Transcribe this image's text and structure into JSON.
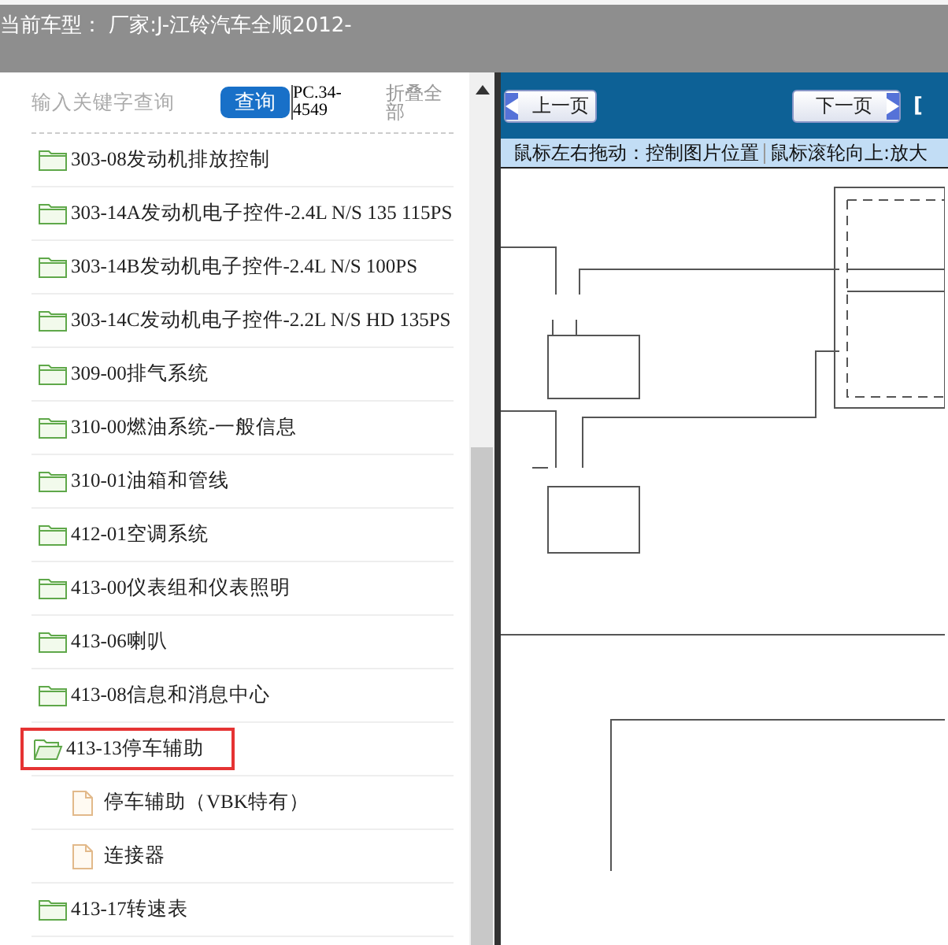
{
  "header": {
    "title": "当前车型：  厂家:J-江铃汽车全顺2012-"
  },
  "search": {
    "placeholder": "输入关键字查询",
    "button": "查询",
    "code": "PC.34-4549",
    "collapse": "折叠全部"
  },
  "tree": [
    {
      "kind": "folder",
      "label": "303-08发动机排放控制",
      "expanded": false,
      "selected": false
    },
    {
      "kind": "folder",
      "label": "303-14A发动机电子控件-2.4L N/S 135 115PS",
      "expanded": false,
      "selected": false
    },
    {
      "kind": "folder",
      "label": "303-14B发动机电子控件-2.4L N/S 100PS",
      "expanded": false,
      "selected": false
    },
    {
      "kind": "folder",
      "label": "303-14C发动机电子控件-2.2L N/S HD 135PS",
      "expanded": false,
      "selected": false
    },
    {
      "kind": "folder",
      "label": "309-00排气系统",
      "expanded": false,
      "selected": false
    },
    {
      "kind": "folder",
      "label": "310-00燃油系统-一般信息",
      "expanded": false,
      "selected": false
    },
    {
      "kind": "folder",
      "label": "310-01油箱和管线",
      "expanded": false,
      "selected": false
    },
    {
      "kind": "folder",
      "label": "412-01空调系统",
      "expanded": false,
      "selected": false
    },
    {
      "kind": "folder",
      "label": "413-00仪表组和仪表照明",
      "expanded": false,
      "selected": false
    },
    {
      "kind": "folder",
      "label": "413-06喇叭",
      "expanded": false,
      "selected": false
    },
    {
      "kind": "folder",
      "label": "413-08信息和消息中心",
      "expanded": false,
      "selected": false
    },
    {
      "kind": "folder",
      "label": "413-13停车辅助",
      "expanded": true,
      "selected": true,
      "children": [
        {
          "kind": "file",
          "label": "停车辅助（VBK特有）",
          "selected": false
        },
        {
          "kind": "file",
          "label": "连接器",
          "selected": false
        }
      ]
    },
    {
      "kind": "folder",
      "label": "413-17转速表",
      "expanded": false,
      "selected": false
    }
  ],
  "viewer": {
    "prev": "上一页",
    "next": "下一页",
    "bracket": "[",
    "hints": [
      "鼠标左右拖动：控制图片位置",
      "鼠标滚轮向上:放大"
    ]
  }
}
